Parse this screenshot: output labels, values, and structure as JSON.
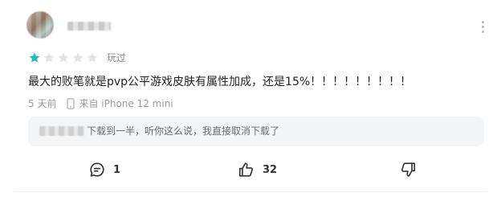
{
  "review": {
    "author_name": "",
    "rating": 1,
    "rating_max": 5,
    "played_label": "玩过",
    "text": "最大的败笔就是pvp公平游戏皮肤有属性加成，还是15%！！！！！！！！！",
    "time": "5 天前",
    "device": "来自 iPhone 12 mini"
  },
  "reply": {
    "author_name": "",
    "text": "下载到一半，听你这么说，我直接取消下载了"
  },
  "actions": {
    "comment_count": "1",
    "like_count": "32"
  },
  "icons": {
    "more": "more-vertical-icon",
    "comment": "comment-icon",
    "like": "thumbs-up-icon",
    "dislike": "thumbs-down-icon",
    "device": "phone-icon"
  },
  "colors": {
    "star_filled": "#14c4b8",
    "star_empty": "#e3e3e3",
    "reply_bg": "#f4f5f7"
  }
}
